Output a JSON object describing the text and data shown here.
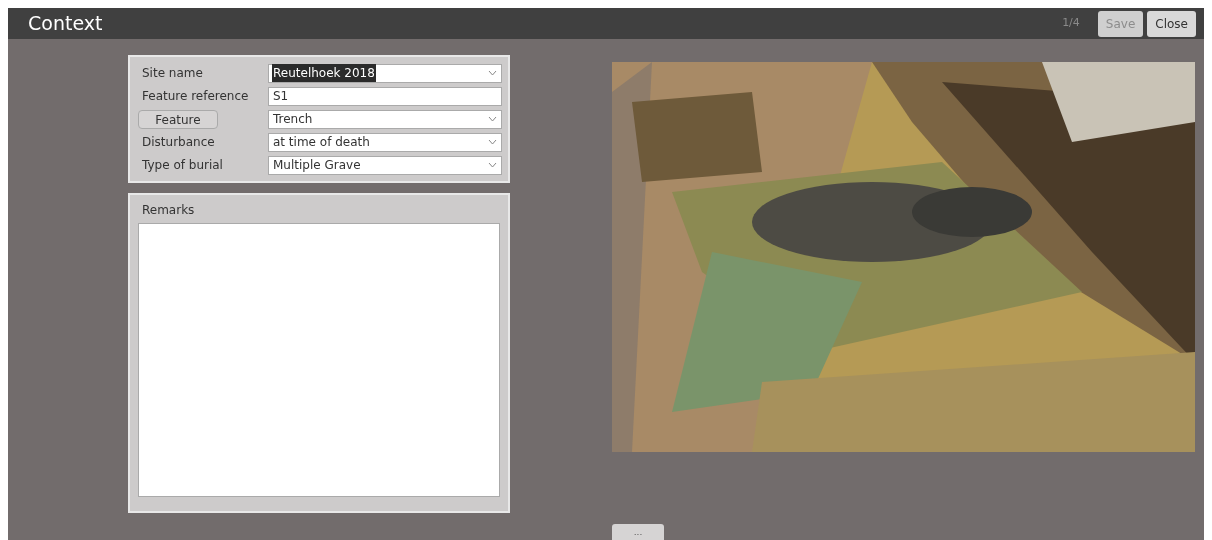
{
  "window": {
    "title": "Context"
  },
  "toolbar": {
    "counter": "1/4",
    "buttons": [
      {
        "label": "Save",
        "disabled": true
      },
      {
        "label": "Close",
        "disabled": false
      }
    ]
  },
  "form": {
    "fields": [
      {
        "label": "Site name",
        "kind": "select",
        "value": "Reutelhoek 2018",
        "highlighted": true
      },
      {
        "label": "Feature reference",
        "kind": "text",
        "value": "S1",
        "highlighted": false
      },
      {
        "label": "Feature",
        "kind": "button_select",
        "value": "Trench",
        "highlighted": false
      },
      {
        "label": "Disturbance",
        "kind": "select",
        "value": "at time of death",
        "highlighted": false
      },
      {
        "label": "Type of burial",
        "kind": "select",
        "value": "Multiple Grave",
        "highlighted": false
      }
    ]
  },
  "remarks": {
    "label": "Remarks"
  },
  "more_button": {
    "label": "..."
  }
}
